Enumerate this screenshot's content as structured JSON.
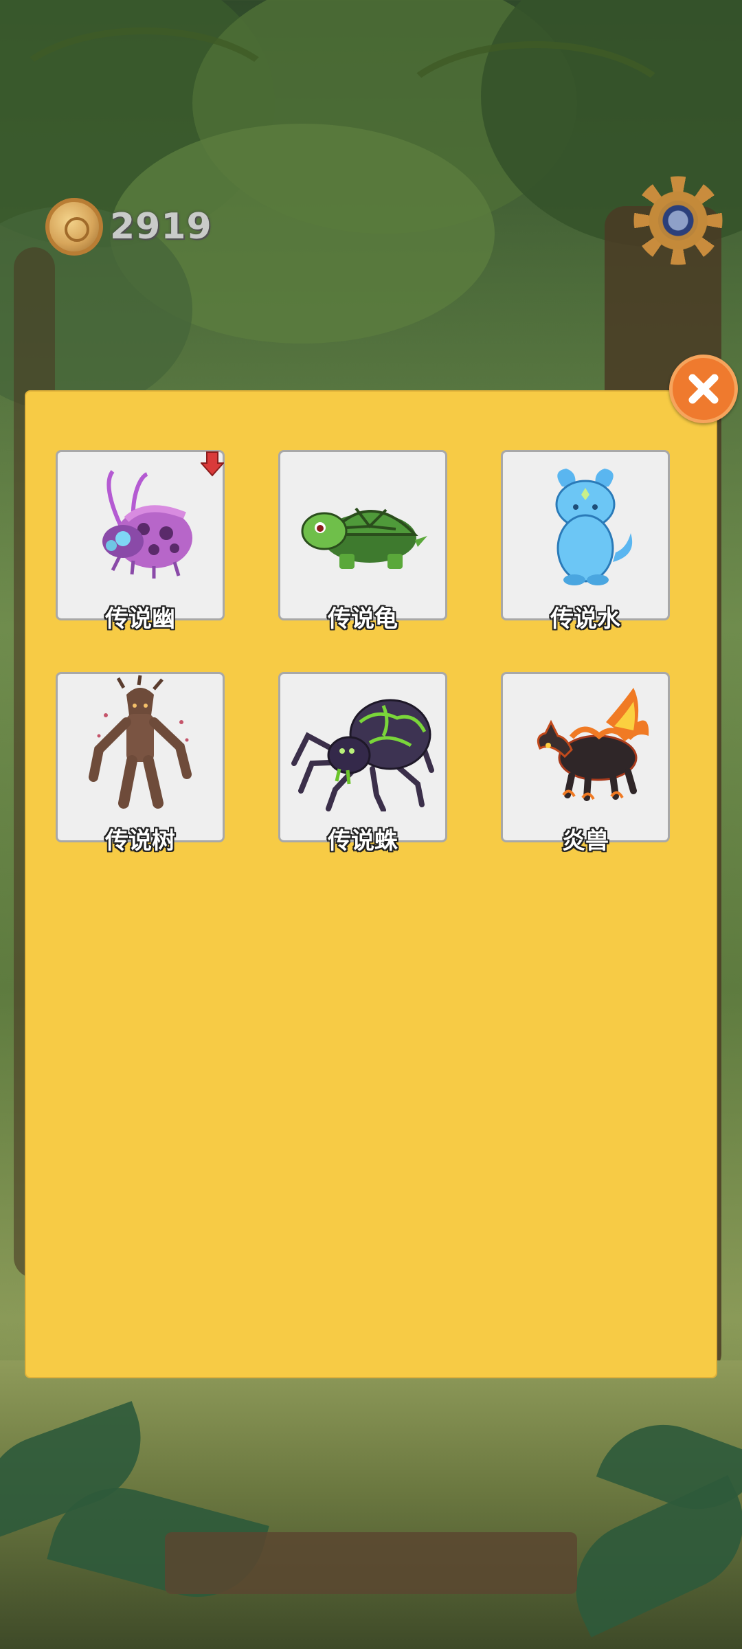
{
  "hud": {
    "coins": "2919",
    "coin_icon": "gold-coin-icon",
    "settings_icon": "gear-icon"
  },
  "dialog": {
    "close_icon": "close-icon",
    "close_color": "#ef7a2e",
    "panel_color": "#f7cb45",
    "cards": [
      {
        "name": "传说幽",
        "icon": "purple-beetle-icon",
        "badge": "red-down-arrow-icon"
      },
      {
        "name": "传说龟",
        "icon": "green-turtle-icon"
      },
      {
        "name": "传说水",
        "icon": "water-spirit-icon"
      },
      {
        "name": "传说树",
        "icon": "treant-icon"
      },
      {
        "name": "传说蛛",
        "icon": "spider-icon"
      },
      {
        "name": "炎兽",
        "icon": "flame-beast-icon"
      }
    ]
  }
}
